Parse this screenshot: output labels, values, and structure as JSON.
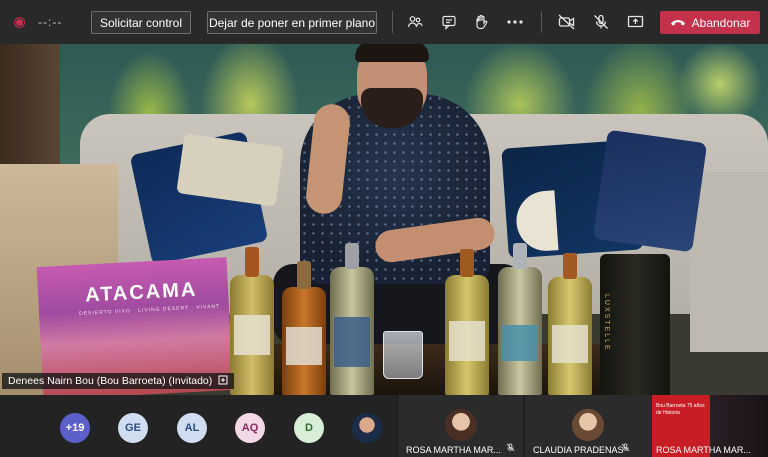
{
  "toolbar": {
    "timer": "--:--",
    "request_control_label": "Solicitar control",
    "unpin_label": "Dejar de poner en primer plano",
    "leave_label": "Abandonar",
    "icons": [
      "record-icon",
      "participants-icon",
      "chat-icon",
      "raise-hand-icon",
      "more-icon",
      "camera-off-icon",
      "mic-off-icon",
      "share-icon",
      "phone-hangup-icon"
    ]
  },
  "stage": {
    "presenter_name": "Denees Nairn Bou (Bou Barroeta) (Invitado)",
    "book_title": "ATACAMA",
    "book_subtitle": "DESIERTO VIVO · LIVING DESERT · VIVANT",
    "box_label": "LUXSTELLE"
  },
  "bottom": {
    "avatars": [
      {
        "initials": "+19",
        "bg": "#5b5fc7",
        "fg": "#ffffff"
      },
      {
        "initials": "GE",
        "bg": "#d0dcef",
        "fg": "#2b4c8a"
      },
      {
        "initials": "AL",
        "bg": "#d0dcef",
        "fg": "#2b4c8a"
      },
      {
        "initials": "AQ",
        "bg": "#f3d8e6",
        "fg": "#8a2b5a"
      },
      {
        "initials": "D",
        "bg": "#d9eed6",
        "fg": "#2f6b2a"
      }
    ],
    "tiles": [
      {
        "name": "ROSA MARTHA MAR..."
      },
      {
        "name": "CLAUDIA PRADENAS"
      },
      {
        "name": "ROSA MARTHA MAR..."
      }
    ],
    "promo_text": "Bou Barroeta 75 años de Historia"
  },
  "colors": {
    "leave_red": "#c4314b",
    "toolbar_bg": "#292929"
  }
}
